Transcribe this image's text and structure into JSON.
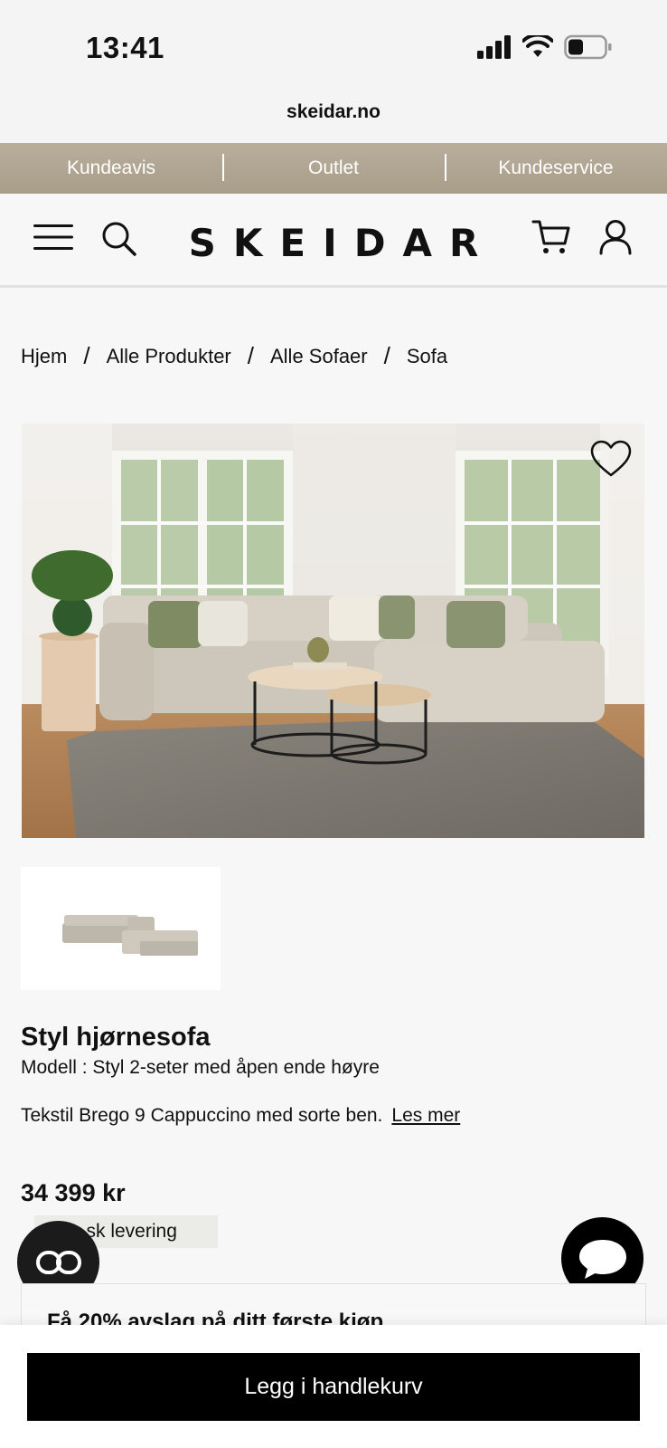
{
  "status": {
    "time": "13:41"
  },
  "browser": {
    "url": "skeidar.no"
  },
  "top_nav": {
    "items": [
      "Kundeavis",
      "Outlet",
      "Kundeservice"
    ]
  },
  "header": {
    "logo": "SKEIDAR"
  },
  "breadcrumb": {
    "items": [
      "Hjem",
      "Alle Produkter",
      "Alle Sofaer",
      "Sofa"
    ],
    "separator": "/"
  },
  "product": {
    "title": "Styl hjørnesofa",
    "model": "Modell : Styl 2-seter med åpen ende høyre",
    "description": "Tekstil Brego 9 Cappuccino med sorte ben.",
    "read_more": "Les mer",
    "price": "34 399 kr",
    "delivery": "...sk levering"
  },
  "promo": {
    "text": "Få 20% avslag på ditt første kjøp"
  },
  "cta": {
    "add_to_cart": "Legg i handlekurv"
  },
  "icons": {
    "menu": "hamburger-icon",
    "search": "search-icon",
    "cart": "cart-icon",
    "account": "user-icon",
    "favorite": "heart-icon",
    "chat_left": "infinity-chat-icon",
    "chat_right": "speech-bubble-icon"
  },
  "colors": {
    "promo_bar": "#b3a893",
    "cta": "#000000",
    "background": "#f7f7f7"
  }
}
